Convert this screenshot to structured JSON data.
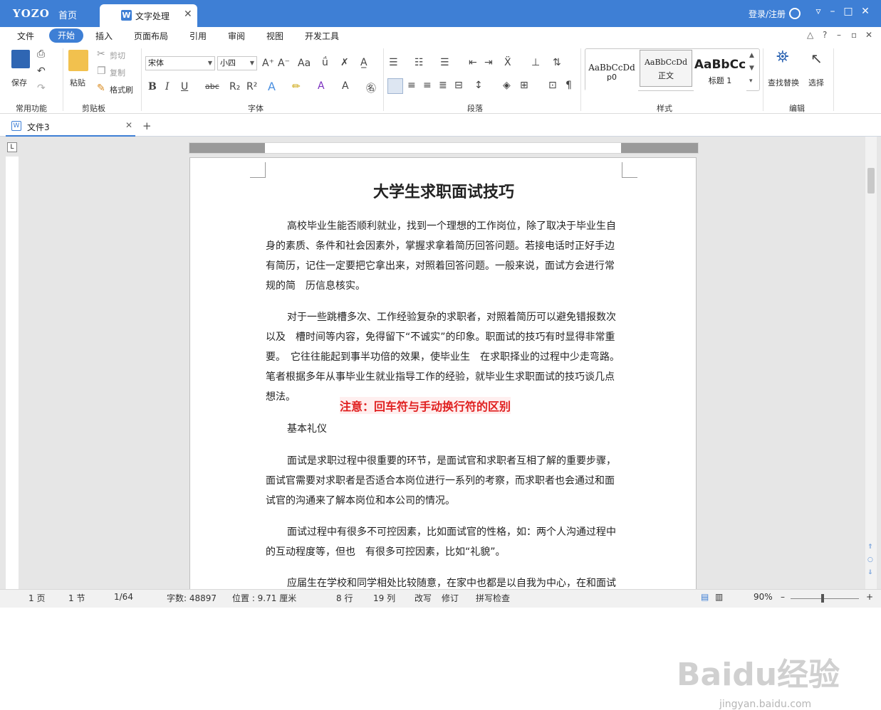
{
  "titlebar": {
    "logo": "YOZO",
    "home": "首页",
    "doc_tab": "文字处理",
    "login": "登录/注册"
  },
  "menu": {
    "tabs": [
      "文件",
      "开始",
      "插入",
      "页面布局",
      "引用",
      "审阅",
      "视图",
      "开发工具"
    ]
  },
  "ribbon": {
    "common": {
      "save": "保存",
      "group": "常用功能"
    },
    "clipboard": {
      "paste": "粘贴",
      "cut": "剪切",
      "copy": "复制",
      "format_painter": "格式刷",
      "group": "剪贴板"
    },
    "font": {
      "family": "宋体",
      "size": "小四",
      "group": "字体"
    },
    "paragraph": {
      "group": "段落"
    },
    "styles": {
      "group": "样式",
      "items": [
        {
          "sample": "AaBbCcDd",
          "name": "p0"
        },
        {
          "sample": "AaBbCcDd",
          "name": "正文"
        },
        {
          "sample": "AaBbCc",
          "name": "标题 1"
        }
      ]
    },
    "edit": {
      "find_replace": "查找替换",
      "select": "选择",
      "group": "编辑"
    }
  },
  "doc_tabs": {
    "active": "文件3"
  },
  "document": {
    "title": "大学生求职面试技巧",
    "paragraphs": [
      "高校毕业生能否顺利就业，找到一个理想的工作岗位，除了取决于毕业生自身的素质、条件和社会因素外，掌握求拿着简历回答问题。若接电话时正好手边有简历，记住一定要把它拿出来，对照着回答问题。一般来说，面试方会进行常规的简　历信息核实。",
      "对于一些跳槽多次、工作经验复杂的求职者，对照着简历可以避免错报数次以及　槽时间等内容，免得留下“不诚实”的印象。职面试的技巧有时显得非常重要。　它往往能起到事半功倍的效果，使毕业生　在求职择业的过程中少走弯路。笔者根据多年从事毕业生就业指导工作的经验，就毕业生求职面试的技巧谈几点想法。",
      "基本礼仪",
      "面试是求职过程中很重要的环节，是面试官和求职者互相了解的重要步骤，面试官需要对求职者是否适合本岗位进行一系列的考察，而求职者也会通过和面试官的沟通来了解本岗位和本公司的情况。",
      "面试过程中有很多不可控因素，比如面试官的性格，如：两个人沟通过程中的互动程度等，但也　有很多可控因素，比如“礼貌”。",
      "应届生在学校和同学相处比较随意，在家中也都是以自我为中心，在和面试"
    ],
    "annotation": "注意：回车符与手动换行符的区别"
  },
  "status": {
    "page": "1 页",
    "section": "1 节",
    "pages": "1/64",
    "words": "字数: 48897",
    "position": "位置 : 9.71 厘米",
    "line": "8 行",
    "col": "19 列",
    "revise": "改写",
    "track": "修订",
    "spell": "拼写检查",
    "zoom": "90%"
  },
  "watermark": {
    "brand": "Baidu经验",
    "url": "jingyan.baidu.com"
  }
}
